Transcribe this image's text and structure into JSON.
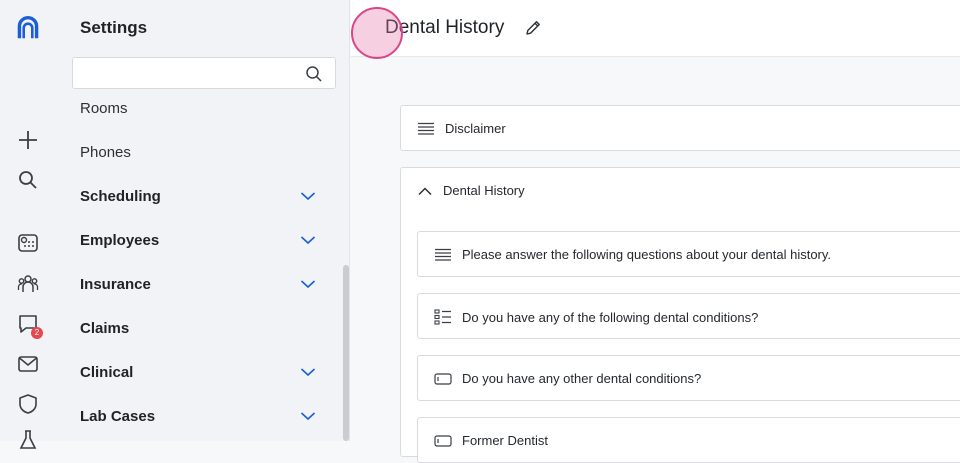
{
  "rail": {
    "icons": [
      "app-logo-icon",
      "plus-icon",
      "search-icon",
      "schedule-icon",
      "people-icon",
      "chat-icon",
      "mail-icon",
      "shield-icon",
      "flask-icon"
    ],
    "chat_badge": "2",
    "accent": "#1a5fd6"
  },
  "sidebar": {
    "title": "Settings",
    "search": {
      "value": "",
      "placeholder": ""
    },
    "items": [
      {
        "label": "Rooms",
        "type": "sub",
        "expandable": false
      },
      {
        "label": "Phones",
        "type": "sub",
        "expandable": false
      },
      {
        "label": "Scheduling",
        "type": "group",
        "expandable": true
      },
      {
        "label": "Employees",
        "type": "group",
        "expandable": true
      },
      {
        "label": "Insurance",
        "type": "group",
        "expandable": true
      },
      {
        "label": "Claims",
        "type": "group",
        "expandable": false
      },
      {
        "label": "Clinical",
        "type": "group",
        "expandable": true
      },
      {
        "label": "Lab Cases",
        "type": "group",
        "expandable": true
      }
    ]
  },
  "main": {
    "title": "Dental History",
    "sections": [
      {
        "label": "Disclaimer",
        "icon": "lines-icon"
      },
      {
        "label": "Dental History",
        "icon": "chevron-up-icon",
        "children": [
          {
            "label": "Please answer the following questions about your dental history.",
            "icon": "lines-icon"
          },
          {
            "label": "Do you have any of the following dental conditions?",
            "icon": "checklist-icon"
          },
          {
            "label": "Do you have any other dental conditions?",
            "icon": "textbox-icon"
          },
          {
            "label": "Former Dentist",
            "icon": "textbox-icon"
          }
        ]
      }
    ]
  }
}
